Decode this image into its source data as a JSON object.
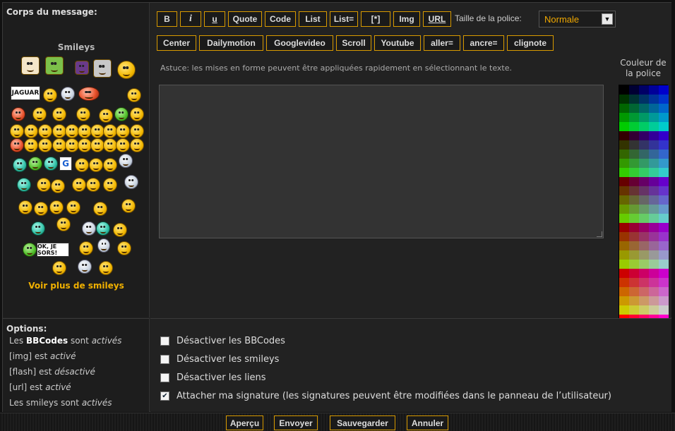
{
  "message_body": {
    "label": "Corps du message:",
    "smileys_title": "Smileys",
    "more_smileys": "Voir plus de smileys",
    "badges": {
      "jaguar": "JAGUAR",
      "ok": "OK, JE SORS!",
      "g": "G"
    }
  },
  "toolbar": {
    "row1": [
      "B",
      "i",
      "u",
      "Quote",
      "Code",
      "List",
      "List=",
      "[*]",
      "Img",
      "URL"
    ],
    "row2": [
      "Center",
      "Dailymotion",
      "Googlevideo",
      "Scroll",
      "Youtube",
      "aller=",
      "ancre=",
      "clignote"
    ],
    "font_size_label": "Taille de la police:",
    "font_size_value": "Normale",
    "hint": "Astuce: les mises en forme peuvent être appliquées rapidement en sélectionnant le texte.",
    "color_title_line1": "Couleur de",
    "color_title_line2": "la police"
  },
  "palette_colors": [
    "#000000",
    "#000033",
    "#000066",
    "#000099",
    "#0000cc",
    "#003300",
    "#003333",
    "#003366",
    "#003399",
    "#0033cc",
    "#006600",
    "#006633",
    "#006666",
    "#006699",
    "#0066cc",
    "#009900",
    "#009933",
    "#009966",
    "#009999",
    "#0099cc",
    "#00cc00",
    "#00cc33",
    "#00cc66",
    "#00cc99",
    "#00cccc",
    "#330000",
    "#330033",
    "#330066",
    "#330099",
    "#3300cc",
    "#333300",
    "#333333",
    "#333366",
    "#333399",
    "#3333cc",
    "#336600",
    "#336633",
    "#336666",
    "#336699",
    "#3366cc",
    "#339900",
    "#339933",
    "#339966",
    "#339999",
    "#3399cc",
    "#33cc00",
    "#33cc33",
    "#33cc66",
    "#33cc99",
    "#33cccc",
    "#660000",
    "#660033",
    "#660066",
    "#660099",
    "#6600cc",
    "#663300",
    "#663333",
    "#663366",
    "#663399",
    "#6633cc",
    "#666600",
    "#666633",
    "#666666",
    "#666699",
    "#6666cc",
    "#669900",
    "#669933",
    "#669966",
    "#669999",
    "#6699cc",
    "#66cc00",
    "#66cc33",
    "#66cc66",
    "#66cc99",
    "#66cccc",
    "#990000",
    "#990033",
    "#990066",
    "#990099",
    "#9900cc",
    "#993300",
    "#993333",
    "#993366",
    "#993399",
    "#9933cc",
    "#996600",
    "#996633",
    "#996666",
    "#996699",
    "#9966cc",
    "#999900",
    "#999933",
    "#999966",
    "#999999",
    "#9999cc",
    "#99cc00",
    "#99cc33",
    "#99cc66",
    "#99cc99",
    "#99cccc",
    "#cc0000",
    "#cc0033",
    "#cc0066",
    "#cc0099",
    "#cc00cc",
    "#cc3300",
    "#cc3333",
    "#cc3366",
    "#cc3399",
    "#cc33cc",
    "#cc6600",
    "#cc6633",
    "#cc6666",
    "#cc6699",
    "#cc66cc",
    "#cc9900",
    "#cc9933",
    "#cc9966",
    "#cc9999",
    "#cc99cc",
    "#cccc00",
    "#cccc33",
    "#cccc66",
    "#cccc99",
    "#cccccc",
    "#ff0000",
    "#ff0033",
    "#ff0066",
    "#ff0099",
    "#ff00cc",
    "#ff3300",
    "#ff3333",
    "#ff3366",
    "#ff3399",
    "#ff33cc",
    "#ff6600",
    "#ff6633",
    "#ff6666",
    "#ff6699",
    "#ff66cc",
    "#ff9900",
    "#ff9933",
    "#ff9966",
    "#ff9999",
    "#ff99cc",
    "#ffcc00",
    "#ffcc33",
    "#ffcc66",
    "#ffcc99",
    "#ffcccc",
    "#ffff00",
    "#ffff33",
    "#ffff66",
    "#ffff99",
    "#ffffff"
  ],
  "options": {
    "title": "Options:",
    "bbcodes_prefix": "Les ",
    "bbcodes_bold": "BBCodes",
    "bbcodes_mid": " sont ",
    "bbcodes_state": "activés",
    "img_label": "[img] est ",
    "img_state": "activé",
    "flash_label": "[flash] est ",
    "flash_state": "désactivé",
    "url_label": "[url] est ",
    "url_state": "activé",
    "smileys_label": "Les smileys sont ",
    "smileys_state": "activés"
  },
  "checkboxes": [
    {
      "label": "Désactiver les BBCodes",
      "checked": false
    },
    {
      "label": "Désactiver les smileys",
      "checked": false
    },
    {
      "label": "Désactiver les liens",
      "checked": false
    },
    {
      "label": "Attacher ma signature (les signatures peuvent être modifiées dans le panneau de l’utilisateur)",
      "checked": true
    }
  ],
  "actions": {
    "preview": "Aperçu",
    "send": "Envoyer",
    "save": "Sauvegarder",
    "cancel": "Annuler"
  },
  "accent_color": "#d89a00"
}
